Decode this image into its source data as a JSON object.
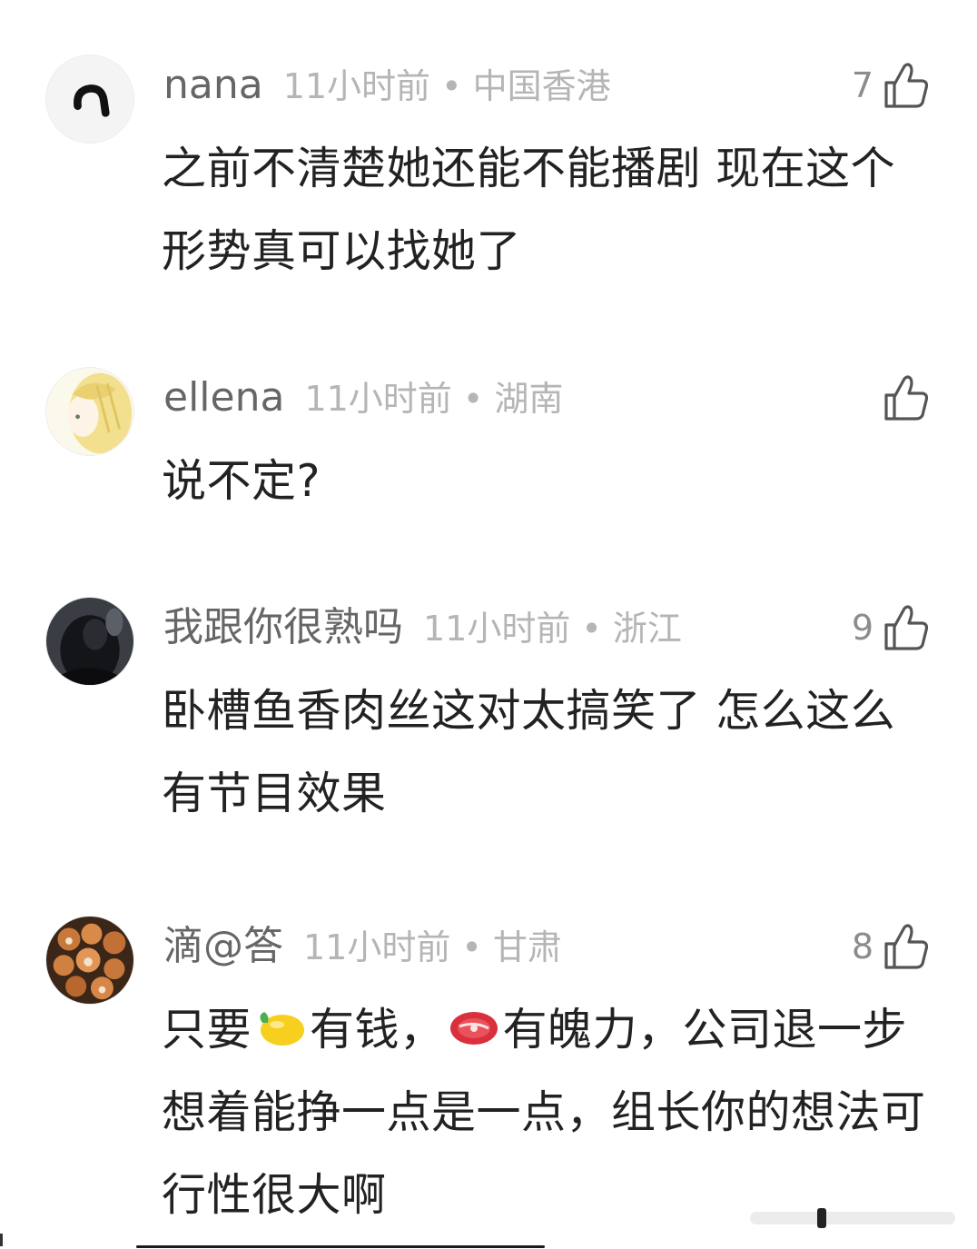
{
  "comments": [
    {
      "name": "nana",
      "time_location": "11小时前 • 中国香港",
      "likes": "7",
      "text": "之前不清楚她还能不能播剧 现在这个形势真可以找她了",
      "avatar_icon": "black-cat-tail-avatar"
    },
    {
      "name": "ellena",
      "time_location": "11小时前 • 湖南",
      "likes": "",
      "text": "说不定?",
      "avatar_icon": "blonde-anime-girl-avatar"
    },
    {
      "name": "我跟你很熟吗",
      "time_location": "11小时前 • 浙江",
      "likes": "9",
      "text": "卧槽鱼香肉丝这对太搞笑了 怎么这么有节目效果",
      "avatar_icon": "dark-hooded-figure-avatar"
    },
    {
      "name": "滴@答",
      "time_location": "11小时前 • 甘肃",
      "likes": "8",
      "text_part1": "只要",
      "text_part2": "有钱，",
      "text_part3": "有魄力，公司退一步想着能挣一点是一点，组长你的想法可行性很大啊",
      "emoji_1": "lemon-emoji",
      "emoji_2": "meat-emoji",
      "avatar_icon": "shiba-dogs-avatar"
    }
  ],
  "colors": {
    "name": "#666666",
    "meta": "#b5b5b5",
    "text": "#222222",
    "icon": "#555555"
  }
}
